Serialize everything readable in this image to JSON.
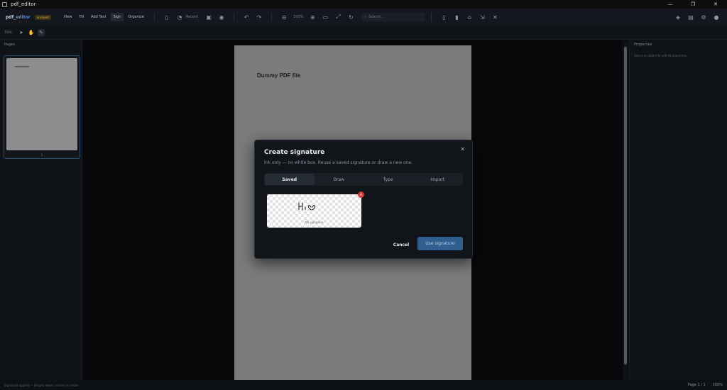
{
  "window": {
    "title": "pdf_editor",
    "minimize": "—",
    "restore": "❐",
    "close": "✕"
  },
  "toolbar": {
    "brand_a": "pdf",
    "brand_b": "_editor",
    "badge": "unsaved",
    "menus": [
      "View",
      "Fill",
      "Add Text",
      "Sign",
      "Organize"
    ],
    "recent": "Recent",
    "zoom": "100%",
    "search_placeholder": "Search..."
  },
  "subbar": {
    "tool_label": "TOOL"
  },
  "pages_panel": {
    "title": "Pages",
    "thumb_number": "1"
  },
  "pdf": {
    "title": "Dummy PDF file"
  },
  "props_panel": {
    "title": "Properties",
    "hint": "Select an object to edit its properties."
  },
  "statusbar": {
    "left": "Signature applied — drag to move, corners to resize",
    "page": "Page 1 / 1",
    "zoom": "100%"
  },
  "modal": {
    "title": "Create signature",
    "subtitle": "Ink only — no white box. Reuse a saved signature or draw a new one.",
    "tabs": [
      "Saved",
      "Draw",
      "Type",
      "Import"
    ],
    "active_tab": "Saved",
    "saved_signature_label": "My signature",
    "delete_glyph": "×",
    "cancel": "Cancel",
    "use": "Use signature",
    "close_glyph": "✕"
  },
  "colors": {
    "accent": "#2f5f8e",
    "danger": "#d23b3b",
    "badge": "#d9a84a"
  }
}
